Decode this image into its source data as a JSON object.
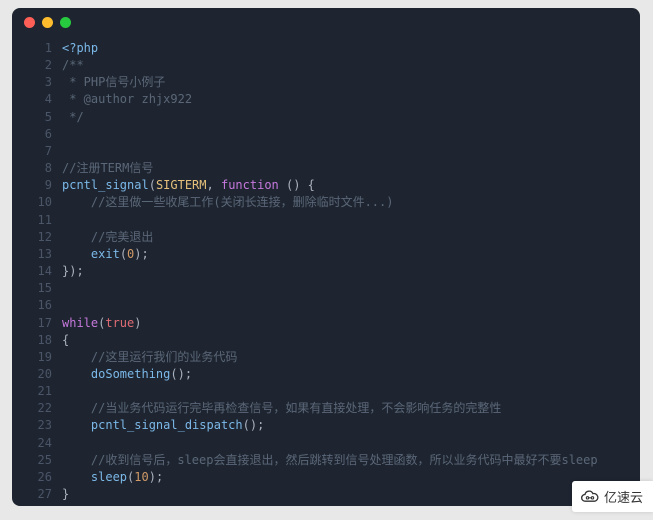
{
  "titlebar": {
    "dots": [
      "close",
      "minimize",
      "zoom"
    ]
  },
  "code": {
    "lines": [
      {
        "n": 1,
        "t": [
          [
            "tag",
            "<?php"
          ]
        ]
      },
      {
        "n": 2,
        "t": [
          [
            "comment",
            "/**"
          ]
        ]
      },
      {
        "n": 3,
        "t": [
          [
            "comment",
            " * PHP信号小例子"
          ]
        ]
      },
      {
        "n": 4,
        "t": [
          [
            "comment",
            " * @author zhjx922"
          ]
        ]
      },
      {
        "n": 5,
        "t": [
          [
            "comment",
            " */"
          ]
        ]
      },
      {
        "n": 6,
        "t": []
      },
      {
        "n": 7,
        "t": []
      },
      {
        "n": 8,
        "t": [
          [
            "comment",
            "//注册TERM信号"
          ]
        ]
      },
      {
        "n": 9,
        "t": [
          [
            "func",
            "pcntl_signal"
          ],
          [
            "punct",
            "("
          ],
          [
            "const",
            "SIGTERM"
          ],
          [
            "punct",
            ", "
          ],
          [
            "keyword",
            "function"
          ],
          [
            "punct",
            " () {"
          ]
        ]
      },
      {
        "n": 10,
        "t": [
          [
            "plain",
            "    "
          ],
          [
            "comment",
            "//这里做一些收尾工作(关闭长连接，删除临时文件...)"
          ]
        ]
      },
      {
        "n": 11,
        "t": []
      },
      {
        "n": 12,
        "t": [
          [
            "plain",
            "    "
          ],
          [
            "comment",
            "//完美退出"
          ]
        ]
      },
      {
        "n": 13,
        "t": [
          [
            "plain",
            "    "
          ],
          [
            "func",
            "exit"
          ],
          [
            "punct",
            "("
          ],
          [
            "num",
            "0"
          ],
          [
            "punct",
            ");"
          ]
        ]
      },
      {
        "n": 14,
        "t": [
          [
            "punct",
            "});"
          ]
        ]
      },
      {
        "n": 15,
        "t": []
      },
      {
        "n": 16,
        "t": []
      },
      {
        "n": 17,
        "t": [
          [
            "keyword",
            "while"
          ],
          [
            "punct",
            "("
          ],
          [
            "bool",
            "true"
          ],
          [
            "punct",
            ")"
          ]
        ]
      },
      {
        "n": 18,
        "t": [
          [
            "punct",
            "{"
          ]
        ]
      },
      {
        "n": 19,
        "t": [
          [
            "plain",
            "    "
          ],
          [
            "comment",
            "//这里运行我们的业务代码"
          ]
        ]
      },
      {
        "n": 20,
        "t": [
          [
            "plain",
            "    "
          ],
          [
            "func",
            "doSomething"
          ],
          [
            "punct",
            "();"
          ]
        ]
      },
      {
        "n": 21,
        "t": []
      },
      {
        "n": 22,
        "t": [
          [
            "plain",
            "    "
          ],
          [
            "comment",
            "//当业务代码运行完毕再检查信号，如果有直接处理，不会影响任务的完整性"
          ]
        ]
      },
      {
        "n": 23,
        "t": [
          [
            "plain",
            "    "
          ],
          [
            "func",
            "pcntl_signal_dispatch"
          ],
          [
            "punct",
            "();"
          ]
        ]
      },
      {
        "n": 24,
        "t": []
      },
      {
        "n": 25,
        "t": [
          [
            "plain",
            "    "
          ],
          [
            "comment",
            "//收到信号后，sleep会直接退出，然后跳转到信号处理函数，所以业务代码中最好不要sleep"
          ]
        ]
      },
      {
        "n": 26,
        "t": [
          [
            "plain",
            "    "
          ],
          [
            "func",
            "sleep"
          ],
          [
            "punct",
            "("
          ],
          [
            "num",
            "10"
          ],
          [
            "punct",
            ");"
          ]
        ]
      },
      {
        "n": 27,
        "t": [
          [
            "punct",
            "}"
          ]
        ]
      }
    ]
  },
  "watermark": {
    "text": "亿速云",
    "icon": "cloud-icon"
  }
}
